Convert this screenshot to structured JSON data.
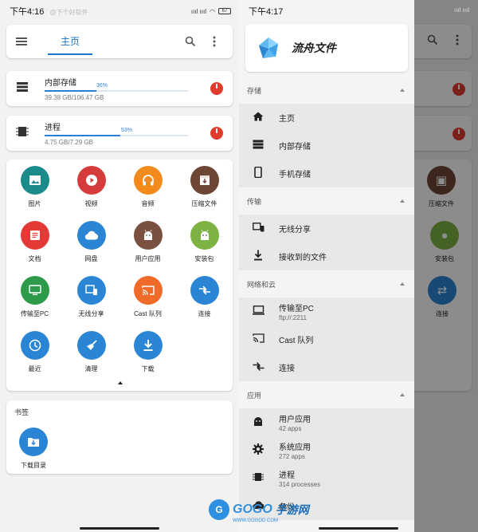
{
  "left": {
    "status": {
      "time": "下午4:16",
      "watermark": "@下个好软件",
      "signal": "ıııl ıııl",
      "battery": "67"
    },
    "appbar": {
      "tab_home": "主页"
    },
    "storage": [
      {
        "name": "内部存储",
        "percent_label": "36%",
        "percent": 36,
        "size": "39.38 GB/106.47 GB"
      },
      {
        "name": "进程",
        "percent_label": "53%",
        "percent": 53,
        "size": "4.75 GB/7.29 GB"
      }
    ],
    "categories": [
      {
        "label": "图片",
        "color": "#1b8a8a",
        "icon": "image-icon"
      },
      {
        "label": "视频",
        "color": "#d63b3b",
        "icon": "play-icon"
      },
      {
        "label": "音频",
        "color": "#f28b1b",
        "icon": "headphones-icon"
      },
      {
        "label": "压缩文件",
        "color": "#6d4636",
        "icon": "archive-icon"
      },
      {
        "label": "文档",
        "color": "#e53935",
        "icon": "document-icon"
      },
      {
        "label": "网盘",
        "color": "#2a86d4",
        "icon": "cloud-icon"
      },
      {
        "label": "用户应用",
        "color": "#7a5040",
        "icon": "android-icon"
      },
      {
        "label": "安装包",
        "color": "#7cb342",
        "icon": "android-icon"
      },
      {
        "label": "传输至PC",
        "color": "#2e9b4a",
        "icon": "ftp-icon"
      },
      {
        "label": "无线分享",
        "color": "#2a86d4",
        "icon": "devices-icon"
      },
      {
        "label": "Cast 队列",
        "color": "#f06a2a",
        "icon": "cast-icon"
      },
      {
        "label": "连接",
        "color": "#2a86d4",
        "icon": "connect-icon"
      },
      {
        "label": "最近",
        "color": "#2a86d4",
        "icon": "clock-icon"
      },
      {
        "label": "清理",
        "color": "#2a86d4",
        "icon": "broom-icon"
      },
      {
        "label": "下载",
        "color": "#2a86d4",
        "icon": "download-icon"
      }
    ],
    "bookmarks": {
      "title": "书签",
      "items": [
        {
          "label": "下载目录",
          "color": "#2a86d4",
          "icon": "download-folder-icon"
        }
      ]
    }
  },
  "right": {
    "status": {
      "time": "下午4:17",
      "signal": "ıııl ıııl",
      "battery": "67"
    },
    "drawer": {
      "app_name": "流舟文件",
      "sections": [
        {
          "title": "存储",
          "items": [
            {
              "label": "主页",
              "icon": "home-icon"
            },
            {
              "label": "内部存储",
              "icon": "storage-icon"
            },
            {
              "label": "手机存储",
              "icon": "phone-icon"
            }
          ]
        },
        {
          "title": "传输",
          "items": [
            {
              "label": "无线分享",
              "icon": "devices-icon"
            },
            {
              "label": "接收到的文件",
              "icon": "download-icon"
            }
          ]
        },
        {
          "title": "网络和云",
          "items": [
            {
              "label": "传输至PC",
              "sub": "ftp://:2211",
              "icon": "computer-icon"
            },
            {
              "label": "Cast 队列",
              "icon": "cast-icon"
            },
            {
              "label": "连接",
              "icon": "connect-icon"
            }
          ]
        },
        {
          "title": "应用",
          "items": [
            {
              "label": "用户应用",
              "sub": "42 apps",
              "icon": "android-icon"
            },
            {
              "label": "系统应用",
              "sub": "272 apps",
              "icon": "settings-icon"
            },
            {
              "label": "进程",
              "sub": "314 processes",
              "icon": "memory-icon"
            },
            {
              "label": "备份",
              "icon": "backup-icon"
            }
          ]
        }
      ]
    },
    "behind_labels": {
      "archive": "压缩文件",
      "apk": "安装包",
      "connect": "连接"
    }
  },
  "watermark": {
    "logo_g": "G",
    "text1": "GOGO",
    "text2": "手游网",
    "url": "WWW.GOGOD.COM"
  }
}
